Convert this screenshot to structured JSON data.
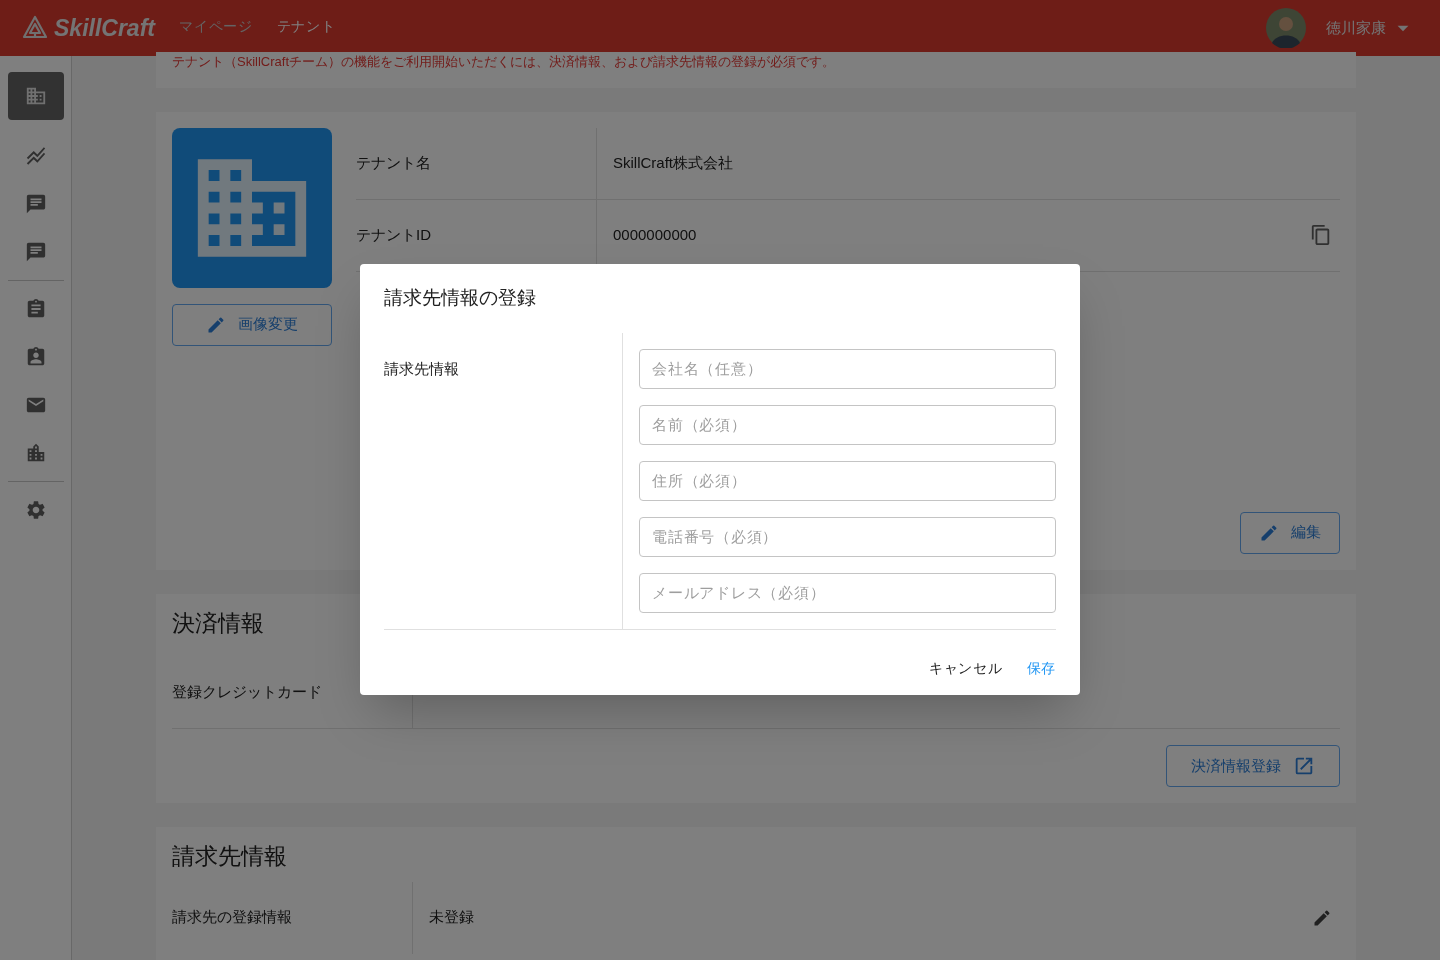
{
  "header": {
    "logo": "SkillCraft",
    "nav": [
      {
        "label": "マイページ",
        "selected": false
      },
      {
        "label": "テナント",
        "selected": true
      }
    ],
    "user": {
      "name": "徳川家康"
    }
  },
  "sidebar": {
    "groups": [
      [
        {
          "kind": "building",
          "selected": true
        },
        {
          "kind": "chart",
          "selected": false
        },
        {
          "kind": "person-chat",
          "selected": false
        },
        {
          "kind": "building-chat",
          "selected": false
        }
      ],
      [
        {
          "kind": "clipboard",
          "selected": false
        },
        {
          "kind": "badge",
          "selected": false
        },
        {
          "kind": "mail",
          "selected": false
        },
        {
          "kind": "city",
          "selected": false
        }
      ],
      [
        {
          "kind": "settings",
          "selected": false
        }
      ]
    ]
  },
  "notice": "テナント（SkillCraftチーム）の機能をご利用開始いただくには、決済情報、および請求先情報の登録が必須です。",
  "tenant": {
    "image_button": "画像変更",
    "rows": [
      {
        "label": "テナント名",
        "value": "SkillCraft株式会社",
        "copy": false
      },
      {
        "label": "テナントID",
        "value": "0000000000",
        "copy": true
      }
    ],
    "edit_button": "編集"
  },
  "payment": {
    "title": "決済情報",
    "rows": [
      {
        "label": "登録クレジットカード"
      }
    ],
    "register_button": "決済情報登録"
  },
  "billing": {
    "title": "請求先情報",
    "rows": [
      {
        "label": "請求先の登録情報",
        "value": "未登録"
      }
    ]
  },
  "dialog": {
    "title": "請求先情報の登録",
    "section_label": "請求先情報",
    "fields": [
      {
        "placeholder": "会社名（任意）"
      },
      {
        "placeholder": "名前（必須）"
      },
      {
        "placeholder": "住所（必須）"
      },
      {
        "placeholder": "電話番号（必須）"
      },
      {
        "placeholder": "メールアドレス（必須）"
      }
    ],
    "actions": [
      {
        "label": "キャンセル",
        "kind": "secondary"
      },
      {
        "label": "保存",
        "kind": "primary"
      }
    ]
  }
}
